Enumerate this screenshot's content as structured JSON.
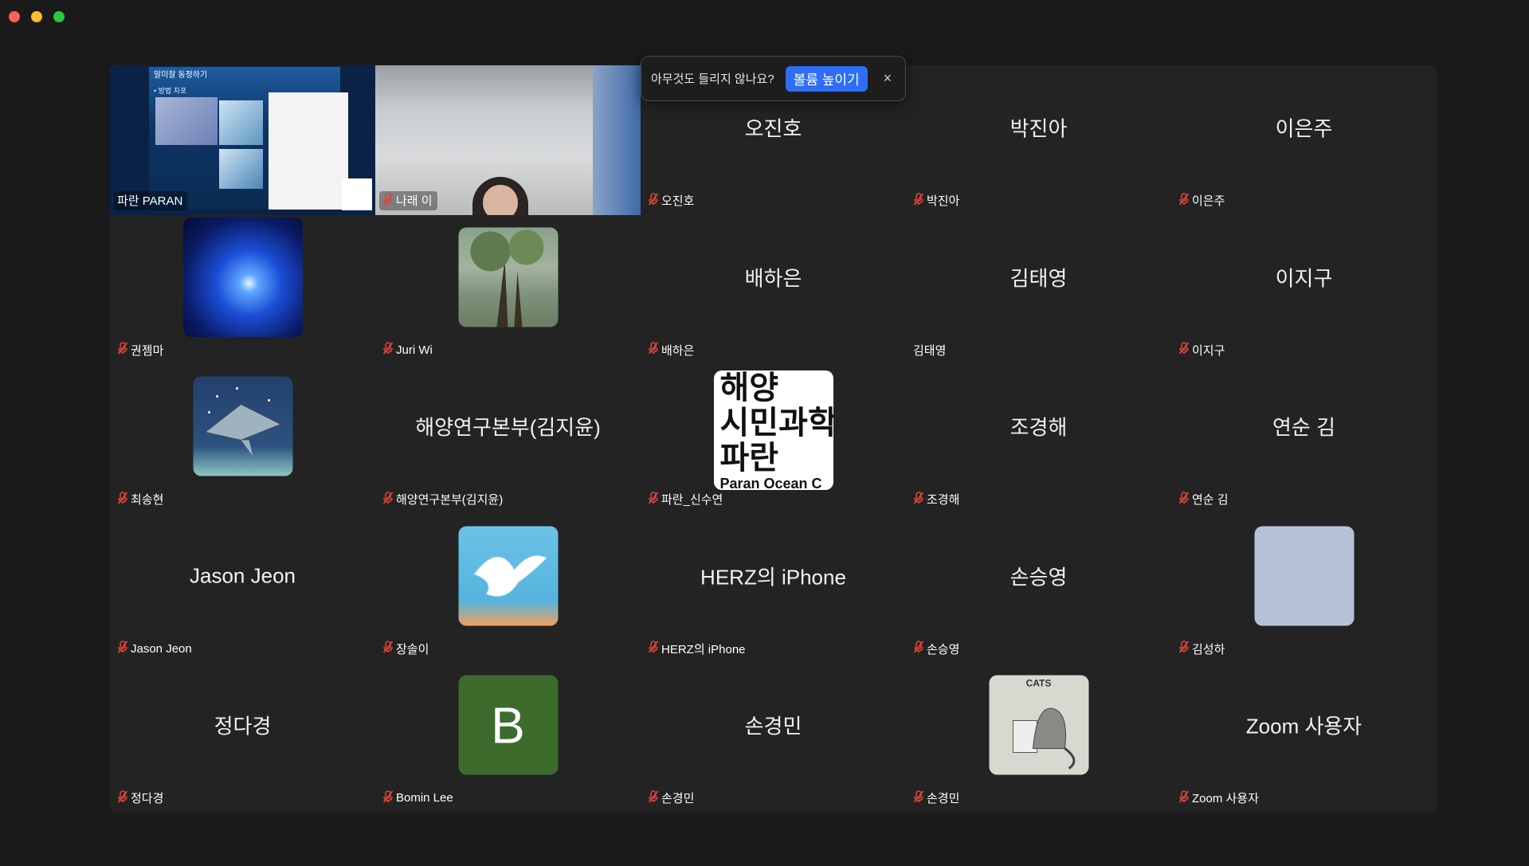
{
  "window": {
    "traffic_lights": [
      "close",
      "minimize",
      "zoom"
    ]
  },
  "notification": {
    "text": "아무것도 들리지 않나요?",
    "button_label": "볼륨 높이기",
    "close_label": "×"
  },
  "slide": {
    "title": "말미잘 동정하기",
    "subtitle": "• 방법   자포"
  },
  "tiles": [
    {
      "display": "video-slide",
      "label": "파란 PARAN",
      "muted": false,
      "active": true
    },
    {
      "display": "video-camera",
      "label": "나래 이",
      "muted": true
    },
    {
      "display": "name",
      "center": "오진호",
      "label": "오진호",
      "muted": true
    },
    {
      "display": "name",
      "center": "박진아",
      "label": "박진아",
      "muted": true
    },
    {
      "display": "name",
      "center": "이은주",
      "label": "이은주",
      "muted": true
    },
    {
      "display": "avatar",
      "avatar": "nebula",
      "label": "권젬마",
      "muted": true
    },
    {
      "display": "avatar",
      "avatar": "tree",
      "label": "Juri Wi",
      "muted": true
    },
    {
      "display": "name",
      "center": "배하은",
      "label": "배하은",
      "muted": true
    },
    {
      "display": "name",
      "center": "김태영",
      "label": "김태영",
      "muted": false
    },
    {
      "display": "name",
      "center": "이지구",
      "label": "이지구",
      "muted": true
    },
    {
      "display": "avatar",
      "avatar": "manta-ray",
      "label": "최송현",
      "muted": true
    },
    {
      "display": "name",
      "center": "해양연구본부(김지윤)",
      "label": "해양연구본부(김지윤)",
      "muted": true
    },
    {
      "display": "avatar",
      "avatar": "text-logo",
      "logo_lines": [
        "해양",
        "시민과학",
        "파란",
        "Paran Ocean C"
      ],
      "label": "파란_신수연",
      "muted": true
    },
    {
      "display": "name",
      "center": "조경해",
      "label": "조경해",
      "muted": true
    },
    {
      "display": "name",
      "center": "연순 김",
      "label": "연순 김",
      "muted": true
    },
    {
      "display": "name",
      "center": "Jason Jeon",
      "label": "Jason Jeon",
      "muted": true
    },
    {
      "display": "avatar",
      "avatar": "bird",
      "label": "장솔이",
      "muted": true
    },
    {
      "display": "name",
      "center": "HERZ의 iPhone",
      "label": "HERZ의 iPhone",
      "muted": true
    },
    {
      "display": "name",
      "center": "손승영",
      "label": "손승영",
      "muted": true
    },
    {
      "display": "avatar",
      "avatar": "blank",
      "label": "김성하",
      "muted": true
    },
    {
      "display": "name",
      "center": "정다경",
      "label": "정다경",
      "muted": true
    },
    {
      "display": "avatar",
      "avatar": "letter",
      "letter": "B",
      "label": "Bomin Lee",
      "muted": true
    },
    {
      "display": "name",
      "center": "손경민",
      "label": "손경민",
      "muted": true
    },
    {
      "display": "avatar",
      "avatar": "cat-sketch",
      "caption": "CATS",
      "label": "손경민",
      "muted": true
    },
    {
      "display": "name",
      "center": "Zoom 사용자",
      "label": "Zoom 사용자",
      "muted": true
    }
  ],
  "colors": {
    "background": "#1a1a1a",
    "tile": "#232323",
    "active_border": "#3ad05a",
    "muted_icon": "#e0443b",
    "primary_button": "#2d6ef5"
  }
}
